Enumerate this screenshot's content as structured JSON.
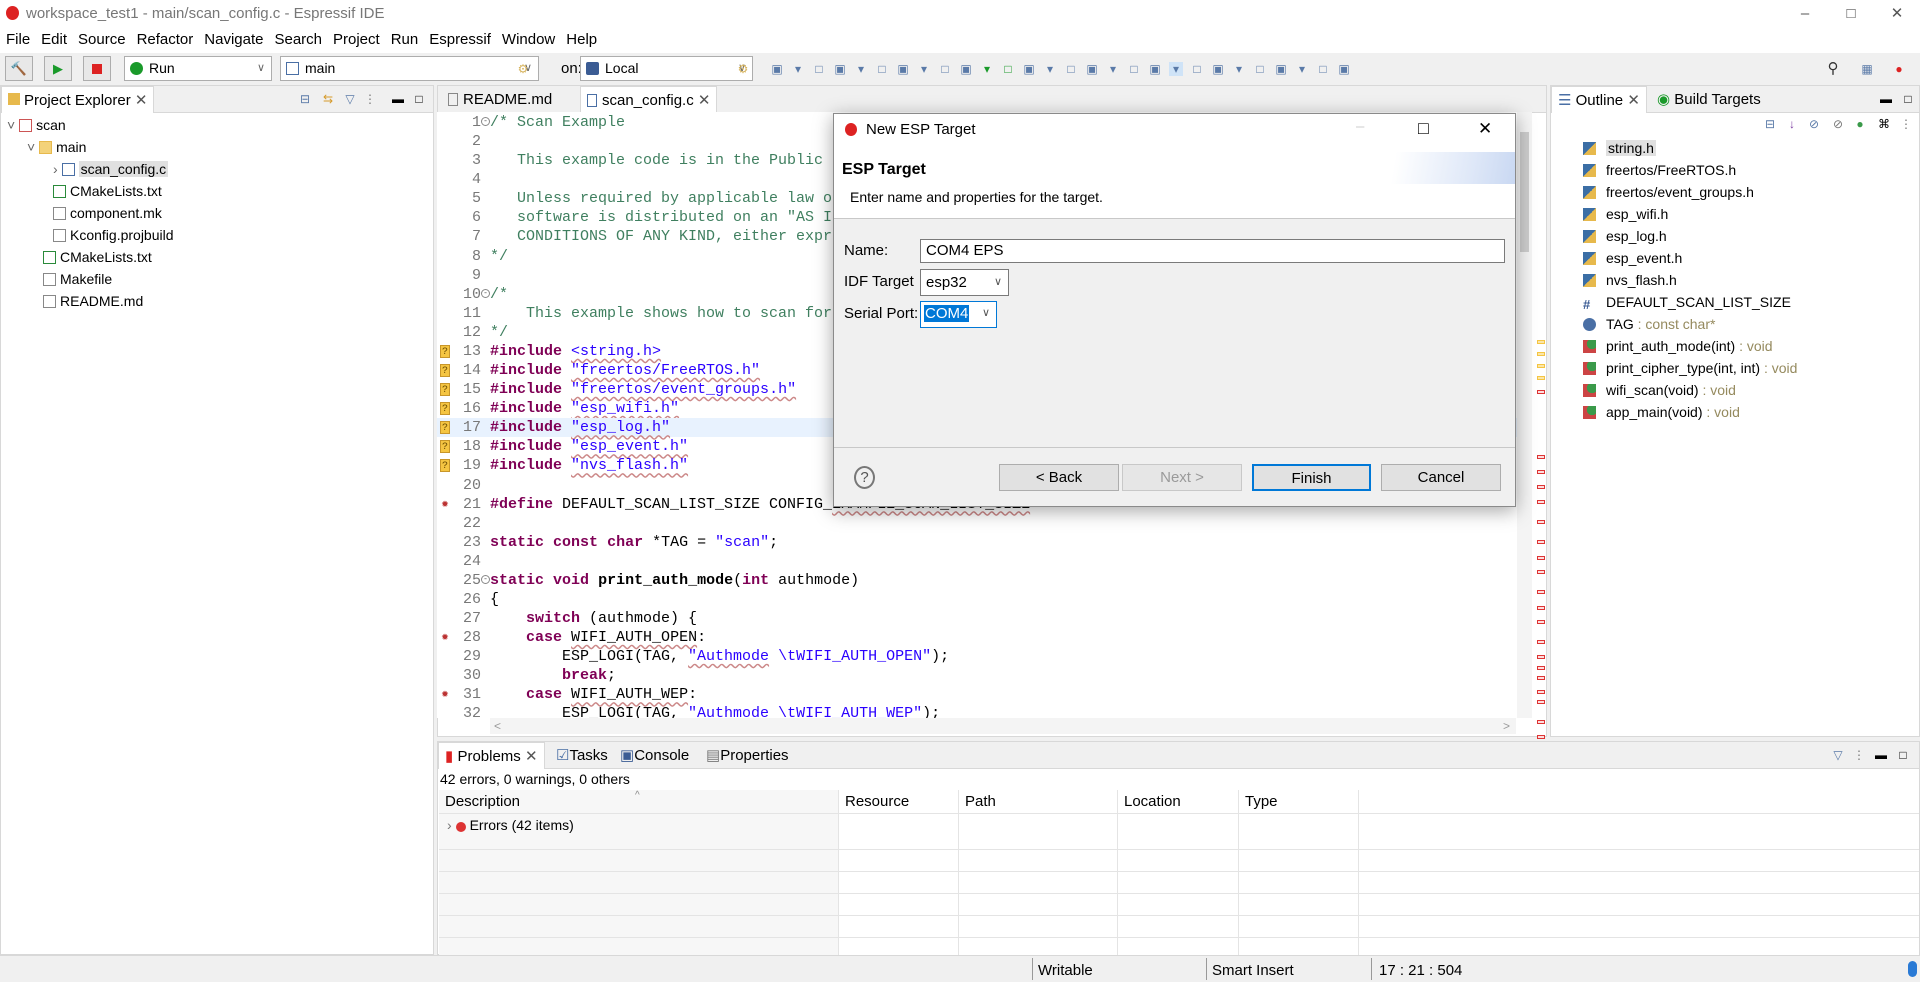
{
  "window": {
    "title": "workspace_test1 - main/scan_config.c - Espressif IDE"
  },
  "menu": [
    "File",
    "Edit",
    "Source",
    "Refactor",
    "Navigate",
    "Search",
    "Project",
    "Run",
    "Espressif",
    "Window",
    "Help"
  ],
  "toolbar": {
    "launch_mode": "Run",
    "launch_config": "main",
    "on_label": "on:",
    "launch_target": "Local"
  },
  "project_explorer": {
    "title": "Project Explorer",
    "items": [
      {
        "label": "scan",
        "level": 0,
        "expanded": true,
        "icon": "project-icon"
      },
      {
        "label": "main",
        "level": 1,
        "expanded": true,
        "icon": "folder-icon"
      },
      {
        "label": "scan_config.c",
        "level": 2,
        "expanded": false,
        "icon": "c-file-icon",
        "selected": true
      },
      {
        "label": "CMakeLists.txt",
        "level": 2,
        "icon": "cmake-icon"
      },
      {
        "label": "component.mk",
        "level": 2,
        "icon": "file-icon"
      },
      {
        "label": "Kconfig.projbuild",
        "level": 2,
        "icon": "file-icon"
      },
      {
        "label": "CMakeLists.txt",
        "level": 1,
        "icon": "cmake-icon"
      },
      {
        "label": "Makefile",
        "level": 1,
        "icon": "file-icon"
      },
      {
        "label": "README.md",
        "level": 1,
        "icon": "file-icon"
      }
    ]
  },
  "editor": {
    "tabs": [
      {
        "label": "README.md",
        "active": false
      },
      {
        "label": "scan_config.c",
        "active": true
      }
    ],
    "current_line": 17,
    "lines": [
      {
        "n": "1",
        "fold": true,
        "t": [
          [
            "/* Scan Example",
            "com"
          ]
        ]
      },
      {
        "n": "2",
        "t": []
      },
      {
        "n": "3",
        "t": [
          [
            "   This example code is in the Public",
            "com"
          ]
        ]
      },
      {
        "n": "4",
        "t": []
      },
      {
        "n": "5",
        "t": [
          [
            "   Unless required by applicable law o",
            "com"
          ]
        ]
      },
      {
        "n": "6",
        "t": [
          [
            "   software is distributed on an \"AS I",
            "com"
          ]
        ]
      },
      {
        "n": "7",
        "t": [
          [
            "   CONDITIONS OF ANY KIND, either expr",
            "com"
          ]
        ]
      },
      {
        "n": "8",
        "t": [
          [
            "*/",
            "com"
          ]
        ]
      },
      {
        "n": "9",
        "t": []
      },
      {
        "n": "10",
        "fold": true,
        "t": [
          [
            "/*",
            "com"
          ]
        ]
      },
      {
        "n": "11",
        "t": [
          [
            "    This example shows how to scan for",
            "com"
          ]
        ]
      },
      {
        "n": "12",
        "t": [
          [
            "*/",
            "com"
          ]
        ]
      },
      {
        "n": "13",
        "m": "warn",
        "t": [
          [
            "#include",
            "kw"
          ],
          [
            " ",
            "pl"
          ],
          [
            "<string.h>",
            "str sq"
          ]
        ]
      },
      {
        "n": "14",
        "m": "warn",
        "t": [
          [
            "#include",
            "kw"
          ],
          [
            " ",
            "pl"
          ],
          [
            "\"freertos/FreeRTOS.h\"",
            "str sq"
          ]
        ]
      },
      {
        "n": "15",
        "m": "warn",
        "t": [
          [
            "#include",
            "kw"
          ],
          [
            " ",
            "pl"
          ],
          [
            "\"freertos/event_groups.h\"",
            "str sq"
          ]
        ]
      },
      {
        "n": "16",
        "m": "warn",
        "t": [
          [
            "#include",
            "kw"
          ],
          [
            " ",
            "pl"
          ],
          [
            "\"esp_wifi.h\"",
            "str sq"
          ]
        ]
      },
      {
        "n": "17",
        "m": "warn",
        "t": [
          [
            "#include",
            "kw"
          ],
          [
            " ",
            "pl"
          ],
          [
            "\"esp_log.h\"",
            "str sq"
          ]
        ]
      },
      {
        "n": "18",
        "m": "warn",
        "t": [
          [
            "#include",
            "kw"
          ],
          [
            " ",
            "pl"
          ],
          [
            "\"esp_event.h\"",
            "str sq"
          ]
        ]
      },
      {
        "n": "19",
        "m": "warn",
        "t": [
          [
            "#include",
            "kw"
          ],
          [
            " ",
            "pl"
          ],
          [
            "\"nvs_flash.h\"",
            "str sq"
          ]
        ]
      },
      {
        "n": "20",
        "t": []
      },
      {
        "n": "21",
        "m": "err",
        "t": [
          [
            "#define",
            "kw"
          ],
          [
            " DEFAULT_SCAN_LIST_SIZE CONFIG_",
            "pl"
          ],
          [
            "EXAMPLE_SCAN_LIST_SIZE",
            "pl sq"
          ]
        ]
      },
      {
        "n": "22",
        "t": []
      },
      {
        "n": "23",
        "t": [
          [
            "static",
            "kw"
          ],
          [
            " ",
            "pl"
          ],
          [
            "const",
            "kw"
          ],
          [
            " ",
            "pl"
          ],
          [
            "char",
            "kw"
          ],
          [
            " *TAG = ",
            "pl"
          ],
          [
            "\"scan\"",
            "str"
          ],
          [
            ";",
            "pl"
          ]
        ]
      },
      {
        "n": "24",
        "t": []
      },
      {
        "n": "25",
        "fold": true,
        "t": [
          [
            "static",
            "kw"
          ],
          [
            " ",
            "pl"
          ],
          [
            "void",
            "kw"
          ],
          [
            " ",
            "pl"
          ],
          [
            "print_auth_mode",
            "fn"
          ],
          [
            "(",
            "pl"
          ],
          [
            "int",
            "kw"
          ],
          [
            " authmode)",
            "pl"
          ]
        ]
      },
      {
        "n": "26",
        "t": [
          [
            "{",
            "pl"
          ]
        ]
      },
      {
        "n": "27",
        "t": [
          [
            "    ",
            "pl"
          ],
          [
            "switch",
            "kw"
          ],
          [
            " (authmode) {",
            "pl"
          ]
        ]
      },
      {
        "n": "28",
        "m": "err",
        "t": [
          [
            "    ",
            "pl"
          ],
          [
            "case",
            "kw"
          ],
          [
            " ",
            "pl"
          ],
          [
            "WIFI_AUTH_OPEN",
            "pl sq"
          ],
          [
            ":",
            "pl"
          ]
        ]
      },
      {
        "n": "29",
        "t": [
          [
            "        ESP_LOGI(TAG, ",
            "pl"
          ],
          [
            "\"Authmode",
            "str sq"
          ],
          [
            " \\tWIFI_AUTH_OPEN\"",
            "str"
          ],
          [
            ");",
            "pl"
          ]
        ]
      },
      {
        "n": "30",
        "t": [
          [
            "        ",
            "pl"
          ],
          [
            "break",
            "kw"
          ],
          [
            ";",
            "pl"
          ]
        ]
      },
      {
        "n": "31",
        "m": "err",
        "t": [
          [
            "    ",
            "pl"
          ],
          [
            "case",
            "kw"
          ],
          [
            " ",
            "pl"
          ],
          [
            "WIFI_AUTH_WEP",
            "pl sq"
          ],
          [
            ":",
            "pl"
          ]
        ]
      },
      {
        "n": "32",
        "t": [
          [
            "        ESP_LOGI(TAG, ",
            "pl"
          ],
          [
            "\"Authmode \\tWIFI_AUTH_WEP\"",
            "str"
          ],
          [
            ");",
            "pl"
          ]
        ]
      }
    ]
  },
  "outline": {
    "tabs": [
      {
        "label": "Outline"
      },
      {
        "label": "Build Targets"
      }
    ],
    "items": [
      {
        "label": "string.h",
        "type": "",
        "icon": "include-icon",
        "selected": true
      },
      {
        "label": "freertos/FreeRTOS.h",
        "type": "",
        "icon": "include-icon"
      },
      {
        "label": "freertos/event_groups.h",
        "type": "",
        "icon": "include-icon"
      },
      {
        "label": "esp_wifi.h",
        "type": "",
        "icon": "include-icon"
      },
      {
        "label": "esp_log.h",
        "type": "",
        "icon": "include-icon"
      },
      {
        "label": "esp_event.h",
        "type": "",
        "icon": "include-icon"
      },
      {
        "label": "nvs_flash.h",
        "type": "",
        "icon": "include-icon"
      },
      {
        "label": "DEFAULT_SCAN_LIST_SIZE",
        "type": "",
        "icon": "macro-icon"
      },
      {
        "label": "TAG",
        "type": " : const char*",
        "icon": "variable-icon"
      },
      {
        "label": "print_auth_mode(int)",
        "type": " : void",
        "icon": "function-icon"
      },
      {
        "label": "print_cipher_type(int, int)",
        "type": " : void",
        "icon": "function-icon"
      },
      {
        "label": "wifi_scan(void)",
        "type": " : void",
        "icon": "function-icon"
      },
      {
        "label": "app_main(void)",
        "type": " : void",
        "icon": "function-icon"
      }
    ]
  },
  "dialog": {
    "title": "New ESP Target",
    "heading": "ESP Target",
    "description": "Enter name and properties for the target.",
    "name_label": "Name:",
    "name_value": "COM4 EPS",
    "idf_label": "IDF Target",
    "idf_value": "esp32",
    "port_label": "Serial Port:",
    "port_value": "COM4",
    "back": "< Back",
    "next": "Next >",
    "finish": "Finish",
    "cancel": "Cancel"
  },
  "problems": {
    "tabs": [
      "Problems",
      "Tasks",
      "Console",
      "Properties"
    ],
    "summary": "42 errors, 0 warnings, 0 others",
    "columns": [
      "Description",
      "Resource",
      "Path",
      "Location",
      "Type"
    ],
    "rows": [
      {
        "description": "Errors (42 items)"
      }
    ]
  },
  "status": {
    "writable": "Writable",
    "insert_mode": "Smart Insert",
    "position": "17 : 21 : 504"
  },
  "colors": {
    "accent": "#0078d7",
    "keyword": "#7f0055",
    "string": "#2a00ff",
    "comment": "#3f7f5f",
    "error": "#d33333"
  }
}
